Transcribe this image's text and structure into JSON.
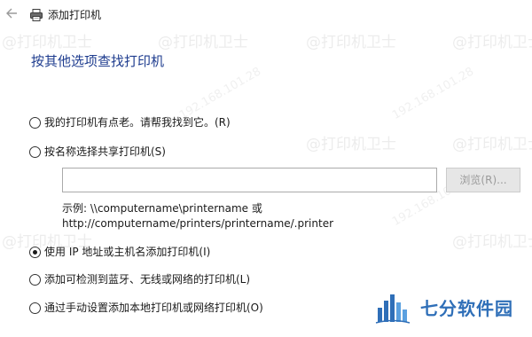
{
  "window": {
    "back_icon": "back-arrow-icon",
    "printer_icon": "printer-icon",
    "title": "添加打印机"
  },
  "heading": "按其他选项查找打印机",
  "options": [
    {
      "label": "我的打印机有点老。请帮我找到它。(R)",
      "checked": false
    },
    {
      "label": "按名称选择共享打印机(S)",
      "checked": false
    },
    {
      "label": "使用 IP 地址或主机名添加打印机(I)",
      "checked": true
    },
    {
      "label": "添加可检测到蓝牙、无线或网络的打印机(L)",
      "checked": false
    },
    {
      "label": "通过手动设置添加本地打印机或网络打印机(O)",
      "checked": false
    }
  ],
  "shared_printer": {
    "input_value": "",
    "browse_label": "浏览(R)...",
    "example_line1": "示例: \\\\computername\\printername 或",
    "example_line2": "http://computername/printers/printername/.printer"
  },
  "watermark": {
    "text": "@打印机卫士",
    "sub_text": "192.168.101.28"
  },
  "brand": {
    "name": "七分软件园",
    "color": "#2f6fb8"
  },
  "colors": {
    "heading": "#1f3d8f",
    "disabled_text": "#9b9b9b"
  }
}
